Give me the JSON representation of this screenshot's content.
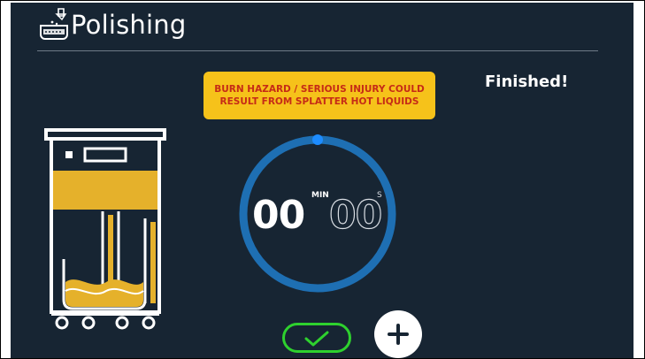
{
  "header": {
    "title": "Polishing",
    "icon": "fryer-polish-icon"
  },
  "warning": {
    "text": "BURN HAZARD / SERIOUS INJURY COULD RESULT FROM SPLATTER HOT LIQUIDS"
  },
  "status": {
    "text": "Finished!"
  },
  "timer": {
    "minutes": "00",
    "minutes_unit": "MIN",
    "seconds": "00",
    "seconds_unit": "S"
  },
  "actions": {
    "confirm_icon": "checkmark-icon",
    "add_icon": "plus-icon"
  },
  "colors": {
    "background": "#172533",
    "warning_bg": "#f6c21a",
    "warning_text": "#c62b16",
    "ring": "#1e6fb3",
    "ring_marker": "#1d8cff",
    "oil": "#e5b12b",
    "confirm": "#2ed12e"
  }
}
